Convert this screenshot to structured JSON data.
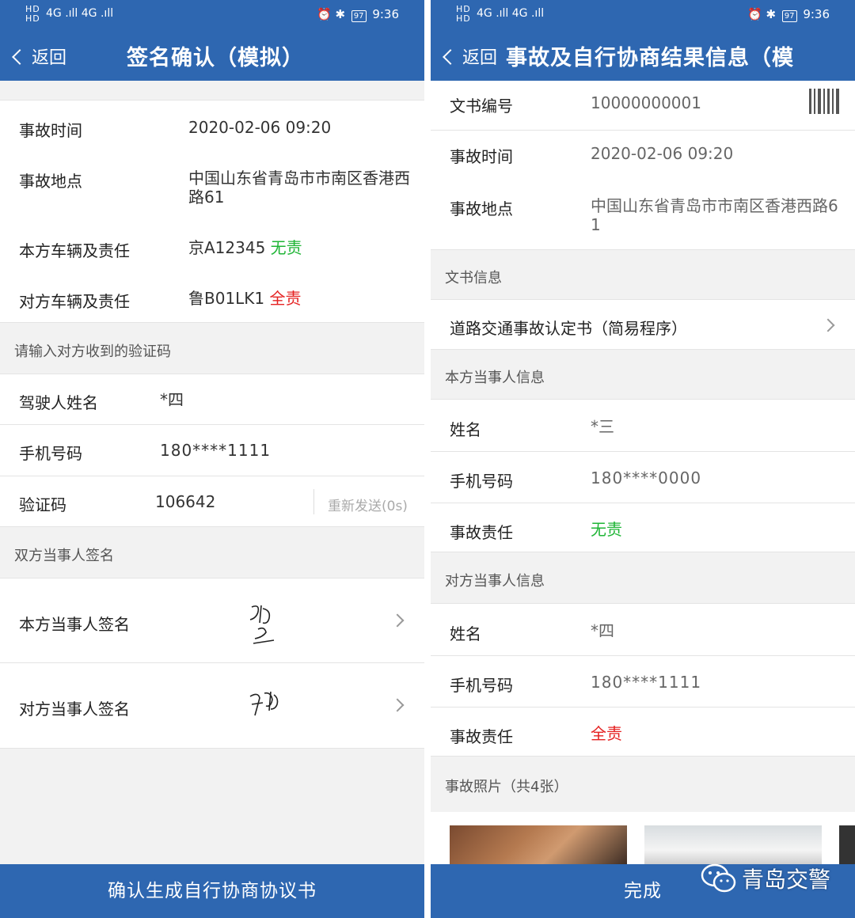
{
  "status": {
    "left_signal": "4G .ıll 4G .ıll",
    "battery": "97",
    "time": "9:36"
  },
  "left": {
    "back_label": "返回",
    "title": "签名确认（模拟）",
    "accident_time_label": "事故时间",
    "accident_time": "2020-02-06 09:20",
    "accident_place_label": "事故地点",
    "accident_place": "中国山东省青岛市市南区香港西路61",
    "own_vehicle_label": "本方车辆及责任",
    "own_plate": "京A12345",
    "own_liability": "无责",
    "other_vehicle_label": "对方车辆及责任",
    "other_plate": "鲁B01LK1",
    "other_liability": "全责",
    "verify_section": "请输入对方收到的验证码",
    "driver_name_label": "驾驶人姓名",
    "driver_name": "*四",
    "phone_label": "手机号码",
    "phone": "180****1111",
    "code_label": "验证码",
    "code": "106642",
    "resend": "重新发送(0s)",
    "sign_section": "双方当事人签名",
    "own_sign_label": "本方当事人签名",
    "other_sign_label": "对方当事人签名",
    "confirm_button": "确认生成自行协商协议书"
  },
  "right": {
    "back_label": "返回",
    "title": "事故及自行协商结果信息（模",
    "doc_no_label": "文书编号",
    "doc_no": "10000000001",
    "accident_time_label": "事故时间",
    "accident_time": "2020-02-06 09:20",
    "accident_place_label": "事故地点",
    "accident_place": "中国山东省青岛市市南区香港西路61",
    "doc_section": "文书信息",
    "doc_item": "道路交通事故认定书（简易程序）",
    "own_section": "本方当事人信息",
    "own_name_label": "姓名",
    "own_name": "*三",
    "own_phone_label": "手机号码",
    "own_phone": "180****0000",
    "own_resp_label": "事故责任",
    "own_resp": "无责",
    "other_section": "对方当事人信息",
    "other_name_label": "姓名",
    "other_name": "*四",
    "other_phone_label": "手机号码",
    "other_phone": "180****1111",
    "other_resp_label": "事故责任",
    "other_resp": "全责",
    "photos_section": "事故照片（共4张）",
    "done_button": "完成"
  },
  "watermark": "青岛交警",
  "colors": {
    "primary": "#2e67b1",
    "no_fault": "#1fb536",
    "full_fault": "#e52222"
  }
}
